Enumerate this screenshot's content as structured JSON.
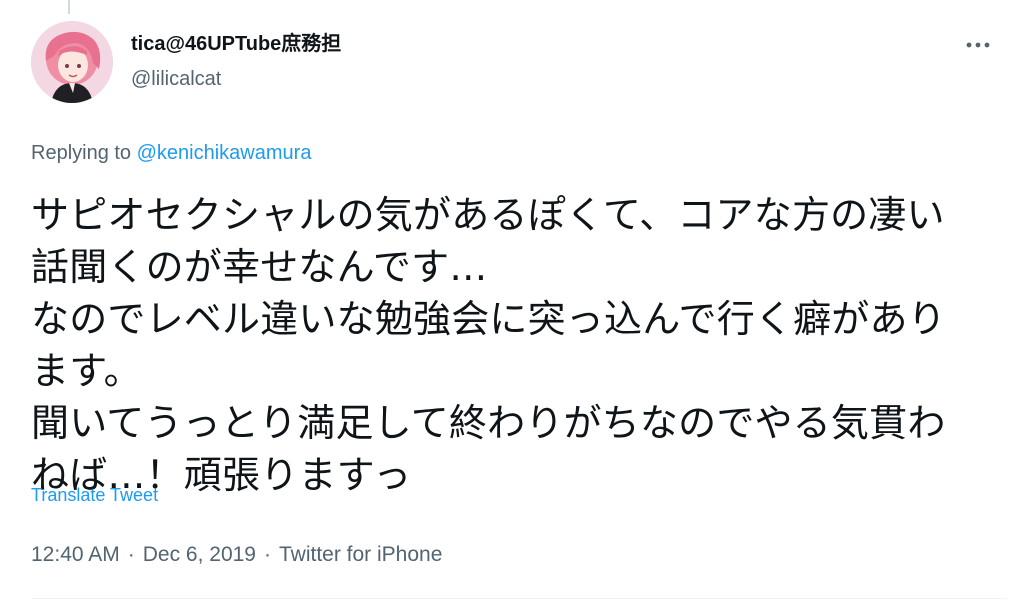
{
  "author": {
    "display_name": "tica@46UPTube庶務担",
    "handle": "@lilicalcat"
  },
  "icons": {
    "avatar": "avatar",
    "more": "more-options-icon"
  },
  "reply": {
    "prefix": "Replying to ",
    "mention": "@kenichikawamura"
  },
  "tweet": {
    "lines": [
      "サピオセクシャルの気があるぽくて、コアな方の凄い",
      "話聞くのが幸せなんです…",
      "なのでレベル違いな勉強会に突っ込んで行く癖があり",
      "ます。",
      "聞いてうっとり満足して終わりがちなのでやる気貫わ",
      "ねば…！頑張りますっ"
    ]
  },
  "translate_label": "Translate Tweet",
  "meta": {
    "time": "12:40 AM",
    "date": "Dec 6, 2019",
    "source": "Twitter for iPhone",
    "separator": "·"
  },
  "colors": {
    "text": "#0f1419",
    "secondary": "#536471",
    "link": "#1d9bf0",
    "divider": "#eff3f4"
  }
}
